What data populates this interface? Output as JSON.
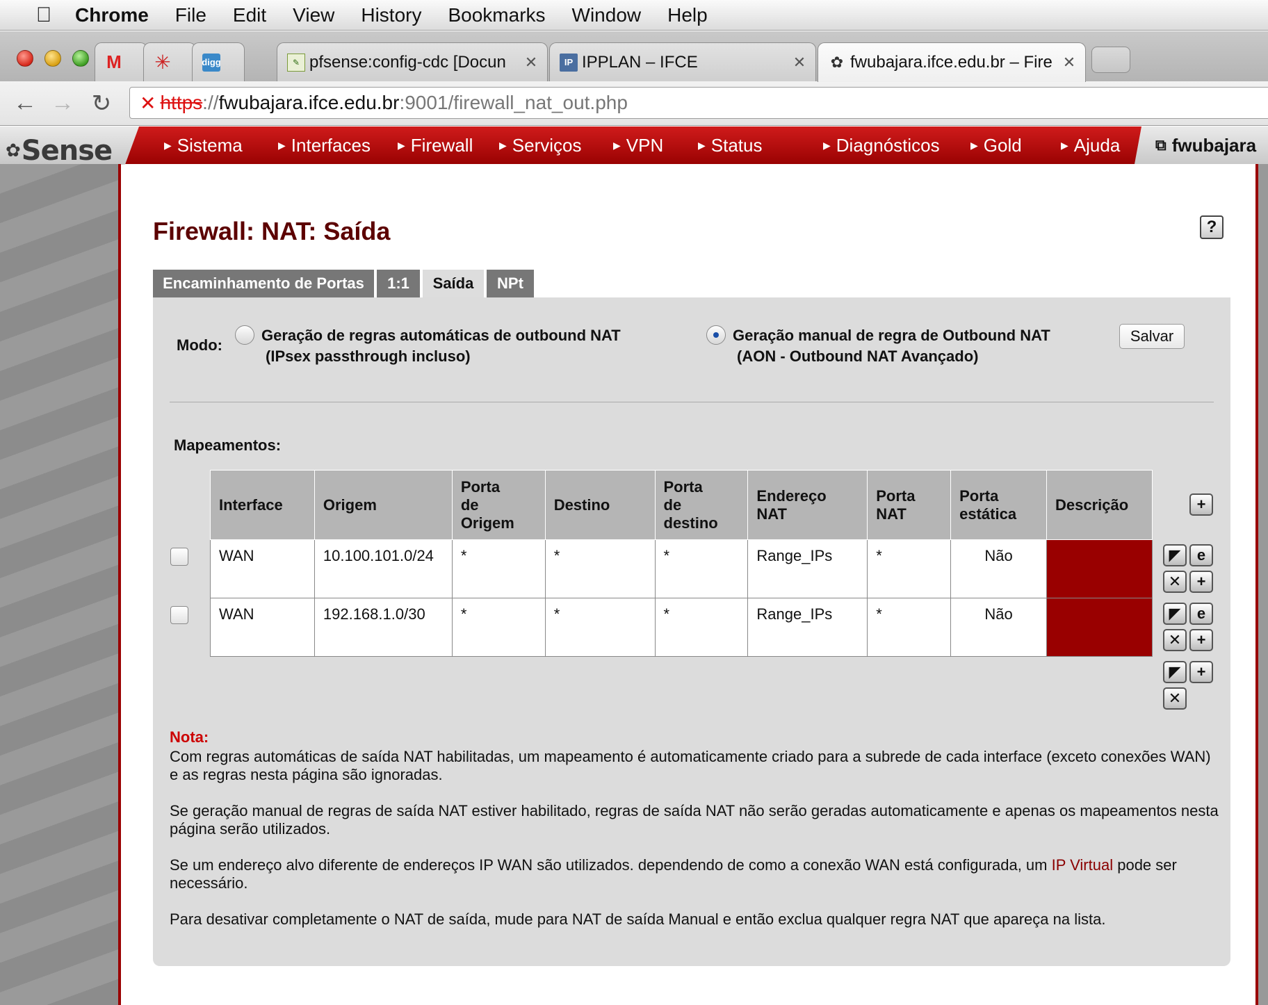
{
  "menubar": {
    "app": "Chrome",
    "items": [
      "File",
      "Edit",
      "View",
      "History",
      "Bookmarks",
      "Window",
      "Help"
    ]
  },
  "browser": {
    "tabs": [
      {
        "title": "",
        "icon": "gmail-icon"
      },
      {
        "title": "",
        "icon": "asterisk-icon"
      },
      {
        "title": "",
        "icon": "digg-icon",
        "icon_text": "digg"
      },
      {
        "title": "pfsense:config-cdc [Docun",
        "icon": "confluence-icon"
      },
      {
        "title": "IPPLAN – IFCE",
        "icon": "ipplan-icon",
        "icon_text": "IP"
      },
      {
        "title": "fwubajara.ifce.edu.br – Fire",
        "icon": "pfsense-icon"
      }
    ],
    "url": {
      "scheme": "https",
      "sep": "://",
      "host": "fwubajara.ifce.edu.br",
      "rest": ":9001/firewall_nat_out.php"
    }
  },
  "pfsense": {
    "logo": "Sense",
    "nav": [
      "Sistema",
      "Interfaces",
      "Firewall",
      "Serviços",
      "VPN",
      "Status",
      "Diagnósticos",
      "Gold",
      "Ajuda"
    ],
    "hostname": "fwubajara"
  },
  "page": {
    "title": "Firewall: NAT: Saída",
    "tabs": [
      "Encaminhamento de Portas",
      "1:1",
      "Saída",
      "NPt"
    ],
    "active_tab": "Saída",
    "mode_label": "Modo:",
    "mode_auto_line1": "Geração de regras automáticas de outbound NAT",
    "mode_auto_line2": "(IPsex passthrough incluso)",
    "mode_manual_line1": "Geração manual de regra de Outbound NAT",
    "mode_manual_line2": "(AON - Outbound NAT Avançado)",
    "selected_mode": "manual",
    "save_label": "Salvar",
    "mappings_label": "Mapeamentos:",
    "columns": [
      {
        "l1": "Interface",
        "l2": "",
        "l3": ""
      },
      {
        "l1": "Origem",
        "l2": "",
        "l3": ""
      },
      {
        "l1": "Porta",
        "l2": "de",
        "l3": "Origem"
      },
      {
        "l1": "Destino",
        "l2": "",
        "l3": ""
      },
      {
        "l1": "Porta",
        "l2": "de",
        "l3": "destino"
      },
      {
        "l1": "Endereço",
        "l2": "NAT",
        "l3": ""
      },
      {
        "l1": "Porta",
        "l2": "NAT",
        "l3": ""
      },
      {
        "l1": "Porta",
        "l2": "estática",
        "l3": ""
      },
      {
        "l1": "Descrição",
        "l2": "",
        "l3": ""
      }
    ],
    "rows": [
      {
        "interface": "WAN",
        "origem": "10.100.101.0/24",
        "porta_origem": "*",
        "destino": "*",
        "porta_destino": "*",
        "endereco_nat": "Range_IPs",
        "porta_nat": "*",
        "porta_estatica": "Não",
        "descricao": ""
      },
      {
        "interface": "WAN",
        "origem": "192.168.1.0/30",
        "porta_origem": "*",
        "destino": "*",
        "porta_destino": "*",
        "endereco_nat": "Range_IPs",
        "porta_nat": "*",
        "porta_estatica": "Não",
        "descricao": ""
      }
    ],
    "note_title": "Nota:",
    "note_p1": "Com regras automáticas de saída NAT habilitadas, um mapeamento é automaticamente criado para a subrede de cada interface (exceto conexões WAN) e as regras nesta página são ignoradas.",
    "note_p2": "Se geração manual de regras de saída NAT estiver habilitado, regras de saída NAT não serão geradas automaticamente e apenas os mapeamentos nesta página serão utilizados.",
    "note_p3_a": "Se um endereço alvo diferente de endereços IP WAN são utilizados. dependendo de como a conexão WAN está configurada, um",
    "note_p3_link": "IP Virtual",
    "note_p3_b": "pode ser necessário.",
    "note_p4": "Para desativar completamente o NAT de saída, mude para NAT de saída Manual e então exclua qualquer regra NAT que apareça na lista."
  },
  "colors": {
    "pfsense_red": "#b30000",
    "title_red": "#5c0000",
    "description_cell": "#990000",
    "note_red": "#cc0000"
  }
}
